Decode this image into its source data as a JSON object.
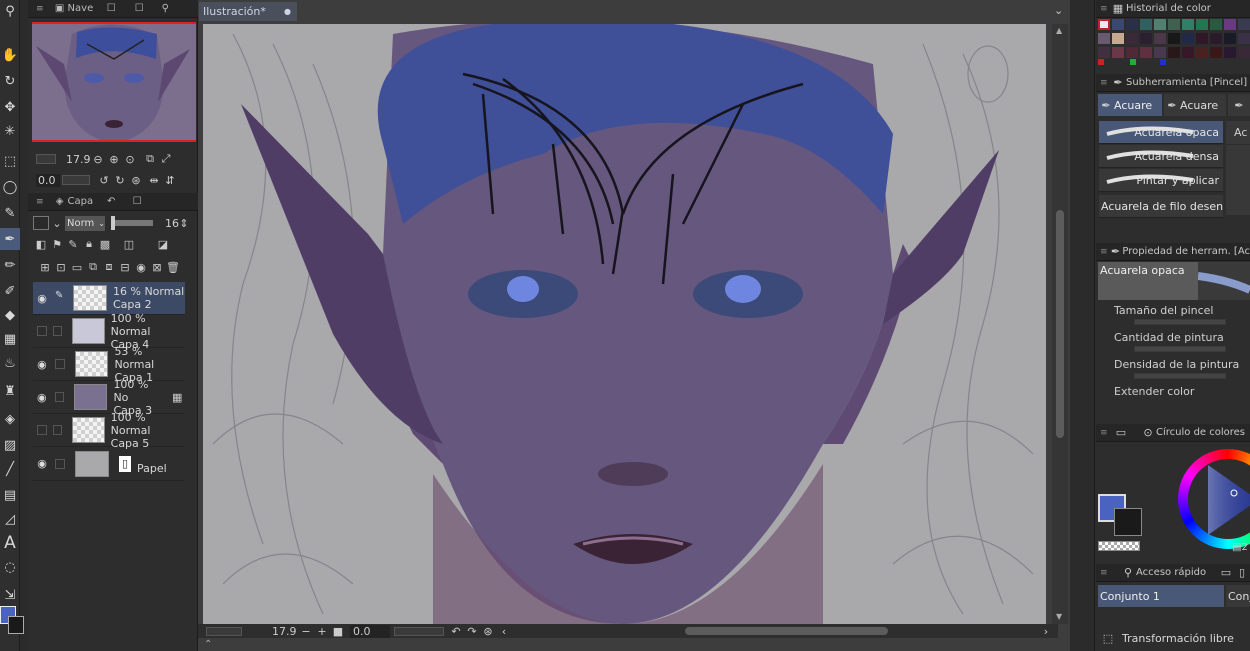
{
  "navigator": {
    "tab_label": "Nave",
    "zoom": "17.9",
    "angle": "0.0"
  },
  "layers_panel": {
    "tab_label": "Capa",
    "blend_mode": "Norm",
    "opacity": "16",
    "layers": [
      {
        "mode": "16 % Normal",
        "name": "Capa 2",
        "visible": true,
        "selected": true
      },
      {
        "mode": "100 % Normal",
        "name": "Capa 4",
        "visible": false,
        "selected": false
      },
      {
        "mode": "53 % Normal",
        "name": "Capa 1",
        "visible": true,
        "selected": false
      },
      {
        "mode": "100 % No",
        "name": "Capa 3",
        "visible": true,
        "selected": false
      },
      {
        "mode": "100 % Normal",
        "name": "Capa 5",
        "visible": false,
        "selected": false
      },
      {
        "mode": "",
        "name": "Papel",
        "visible": true,
        "selected": false
      }
    ]
  },
  "document": {
    "tab_title": "Ilustración*",
    "zoom": "17.9",
    "angle": "0.0"
  },
  "color_history": {
    "title": "Historial de color"
  },
  "subtool": {
    "title": "Subherramienta [Pincel]",
    "tabs": [
      "Acuare",
      "Acuare"
    ],
    "brushes": [
      "Acuarela opaca",
      "Acuarela densa",
      "Pintar y aplicar",
      "Acuarela de filo desenfoc"
    ],
    "side_label": "Ac"
  },
  "tool_property": {
    "title": "Propiedad de herram. [Ac",
    "preview_label": "Acuarela opaca",
    "properties": [
      "Tamaño del pincel",
      "Cantidad de pintura",
      "Densidad de la pintura",
      "Extender color"
    ]
  },
  "color_wheel": {
    "title": "Círculo de colores",
    "value_label": "2"
  },
  "quick_access": {
    "title": "Acceso rápido",
    "set1": "Conjunto 1",
    "set2": "Conj",
    "item": "Transformación libre"
  },
  "colors": {
    "main_color": "#4a63c0",
    "sub_color": "#1a1a1a",
    "accent": "#4a5a7a"
  }
}
